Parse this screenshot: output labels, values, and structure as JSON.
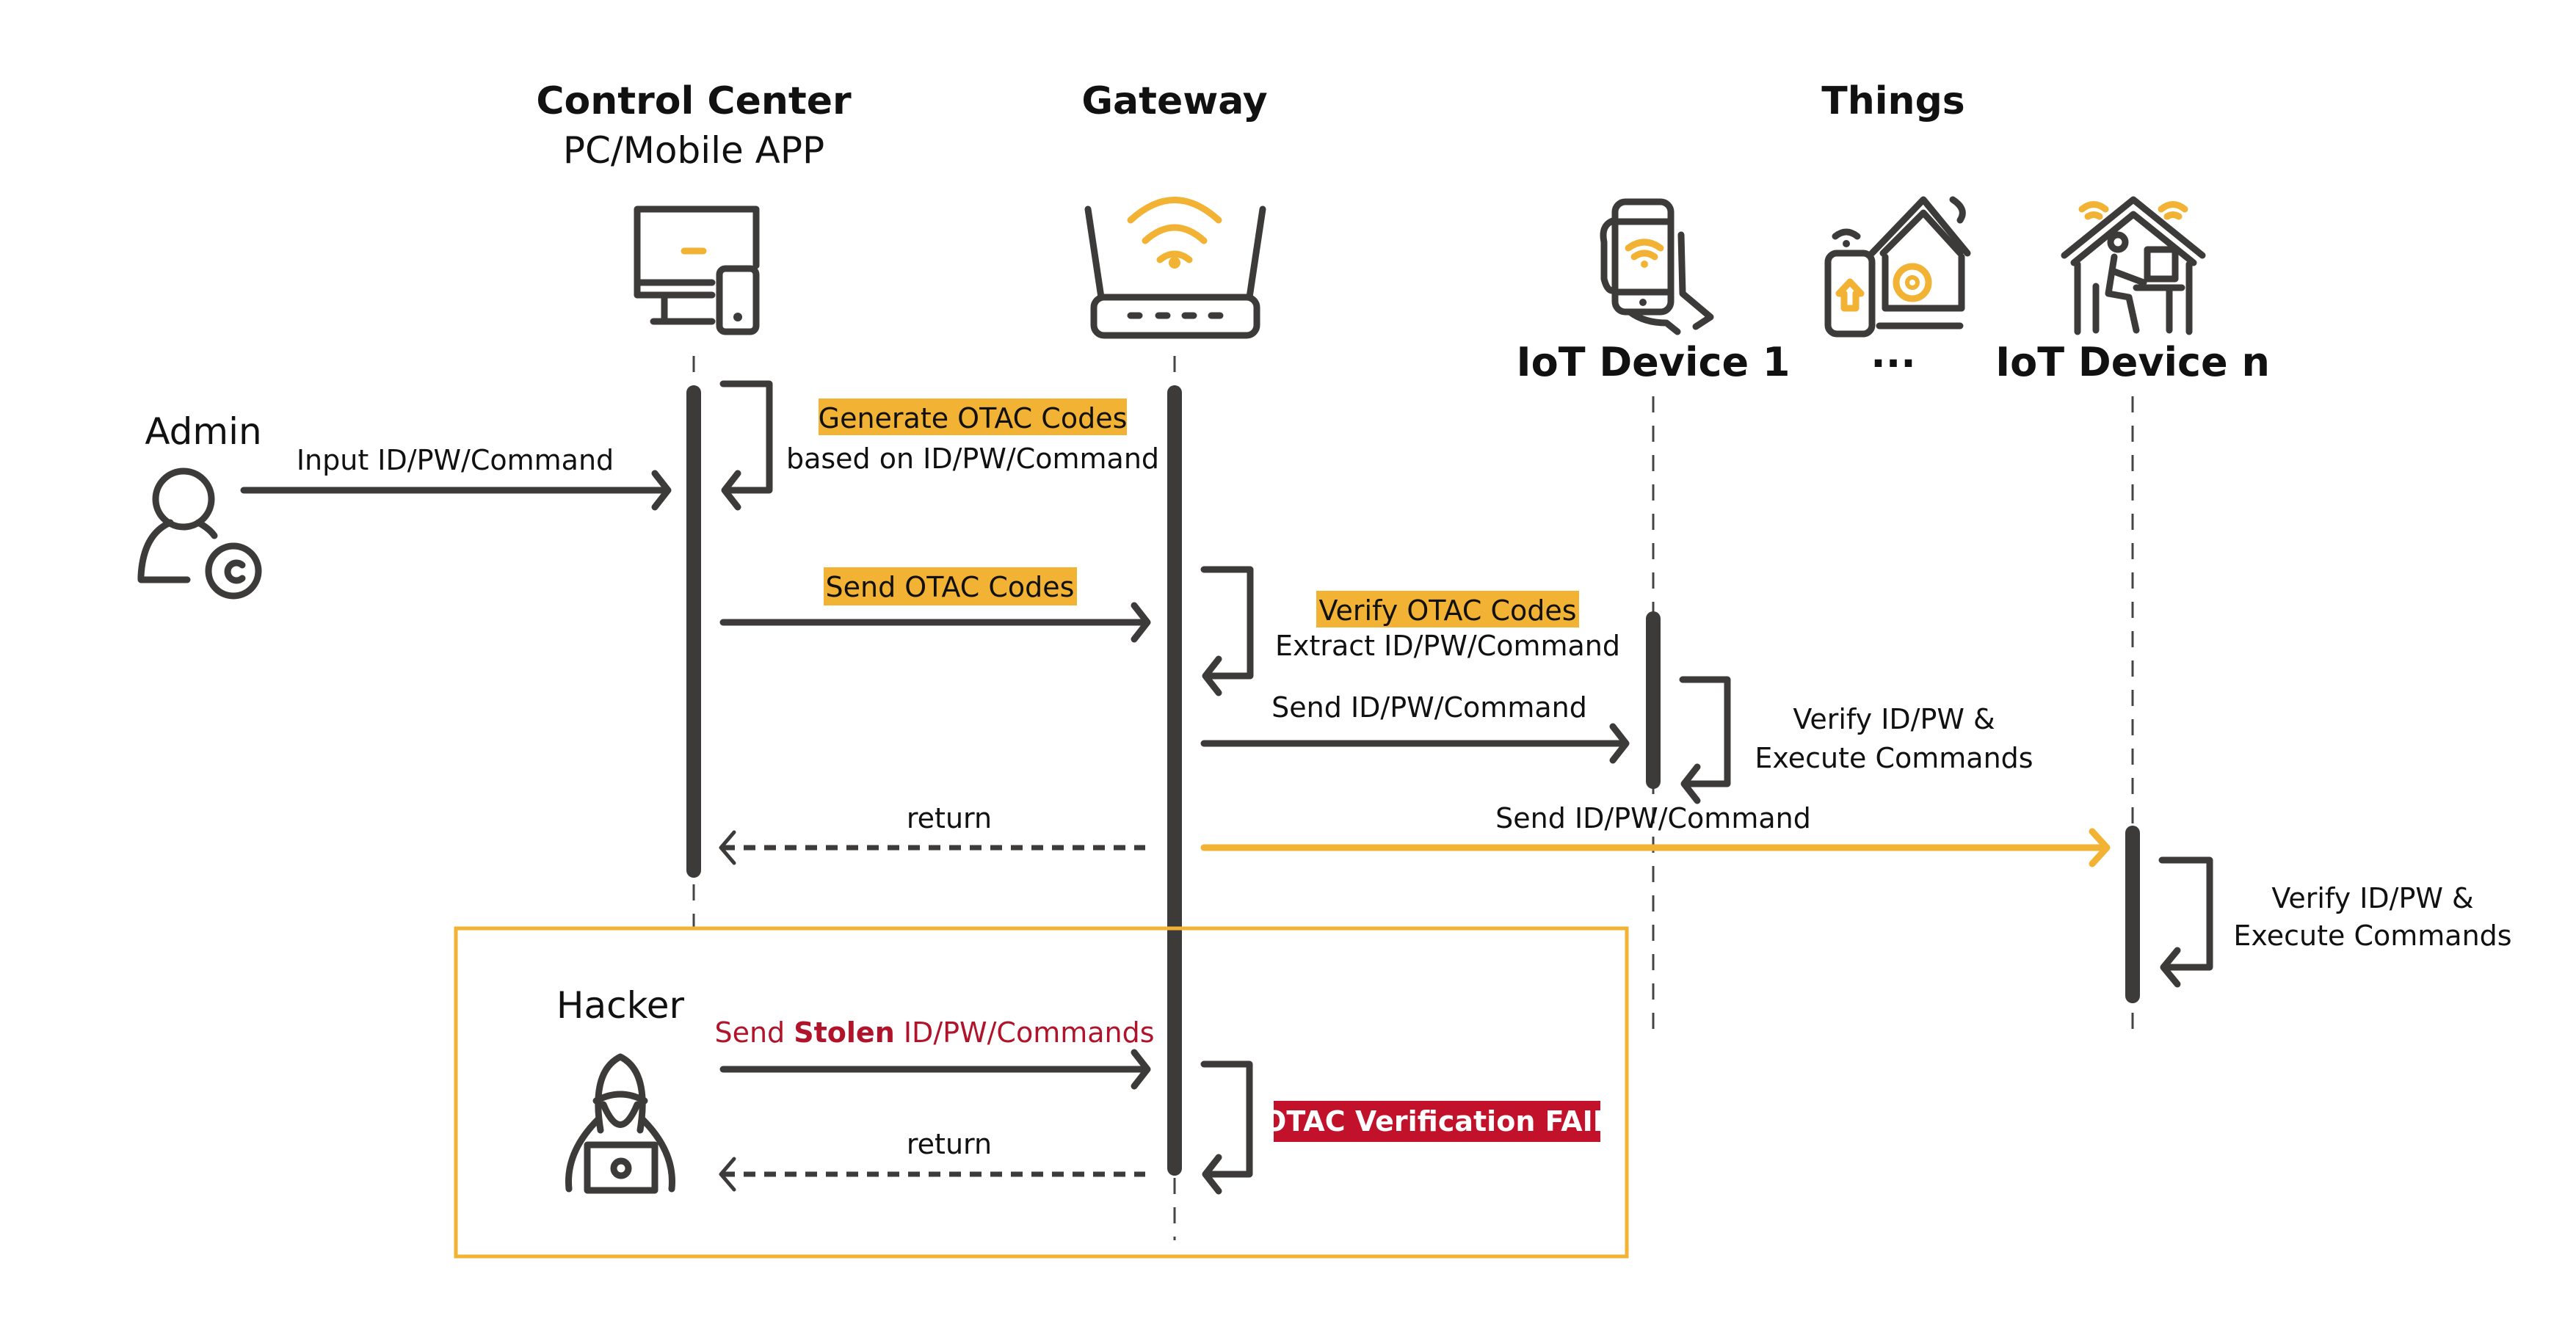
{
  "colors": {
    "accent_yellow": "#f2b233",
    "fail_red": "#c1112b",
    "stolen_text_red": "#b0132a",
    "line_dark": "#3d3a3a"
  },
  "headers": {
    "control_center": "Control Center",
    "control_center_sub": "PC/Mobile APP",
    "gateway": "Gateway",
    "things": "Things"
  },
  "devices": {
    "device_1": "IoT Device 1",
    "ellipsis": "...",
    "device_n": "IoT Device n"
  },
  "actors": {
    "admin": "Admin",
    "hacker": "Hacker"
  },
  "icons": {
    "admin": "admin-user-gear-icon",
    "control_center": "desktop-and-phone-icon",
    "gateway": "wifi-router-icon",
    "device_1": "hand-holding-phone-icon",
    "device_mid": "smart-home-phone-icon",
    "device_n": "house-person-laptop-icon",
    "hacker": "hooded-hacker-laptop-icon"
  },
  "messages": {
    "input": "Input ID/PW/Command",
    "generate_highlight": "Generate OTAC Codes",
    "generate_sub": "based on ID/PW/Command",
    "send_otac": "Send OTAC Codes",
    "verify_highlight": "Verify OTAC Codes",
    "verify_sub": "Extract ID/PW/Command",
    "send_to_device1": "Send ID/PW/Command",
    "device1_verify_line1": "Verify ID/PW &",
    "device1_verify_line2": "Execute Commands",
    "return_cc": "return",
    "send_to_devicen": "Send ID/PW/Command",
    "devicen_verify_line1": "Verify ID/PW &",
    "devicen_verify_line2": "Execute Commands",
    "hacker_send_prefix": "Send ",
    "hacker_send_bold": "Stolen",
    "hacker_send_suffix": " ID/PW/Commands",
    "fail_label": "OTAC Verification FAIL",
    "return_hacker": "return"
  }
}
